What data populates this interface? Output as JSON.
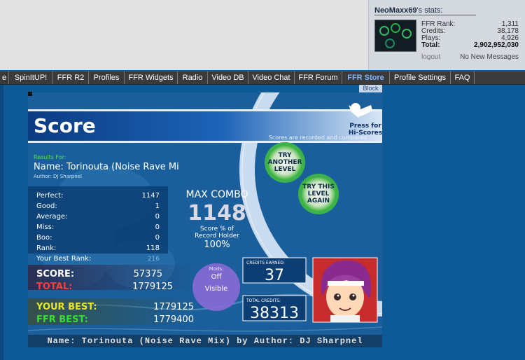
{
  "stats": {
    "username": "NeoMaxx69",
    "title_suffix": "'s stats:",
    "rows": [
      {
        "label": "FFR Rank:",
        "value": "1,311"
      },
      {
        "label": "Credits:",
        "value": "38,178"
      },
      {
        "label": "Plays:",
        "value": "4,926"
      },
      {
        "label": "Total:",
        "value": "2,902,952,030"
      }
    ],
    "logout": "logout",
    "messages": "No New Messages"
  },
  "nav": {
    "items": [
      "e",
      "SpinItUP!",
      "FFR R2",
      "Profiles",
      "FFR Widgets",
      "Radio",
      "Video DB",
      "Video Chat",
      "FFR Forum",
      "FFR Store",
      "Profile Settings",
      "FAQ"
    ],
    "block": "Block"
  },
  "game": {
    "title": "Score",
    "press_for": "Press for",
    "hi_scores": "Hi-Scores",
    "recorded": "Scores are recorded and compared",
    "results_for": "Results For:",
    "song_name": "Name: Torinouta (Noise Rave Mi",
    "author": "Author: DJ Sharpnel",
    "try_another": [
      "TRY",
      "ANOTHER",
      "LEVEL"
    ],
    "try_again": [
      "TRY THIS",
      "LEVEL",
      "AGAIN"
    ],
    "judgements": [
      {
        "label": "Perfect:",
        "value": "1147"
      },
      {
        "label": "Good:",
        "value": "1"
      },
      {
        "label": "Average:",
        "value": "0"
      },
      {
        "label": "Miss:",
        "value": "0"
      },
      {
        "label": "Boo:",
        "value": "0"
      },
      {
        "label": "Rank:",
        "value": "118"
      }
    ],
    "best_rank_label": "Your Best Rank:",
    "best_rank_value": "216",
    "max_combo_label": "MAX COMBO",
    "max_combo_value": "1148",
    "score_pct_l1": "Score % of",
    "score_pct_l2": "Record Holder",
    "score_pct_value": "100%",
    "score_label": "SCORE:",
    "score_value": "57375",
    "total_label": "TOTAL:",
    "total_value": "1779125",
    "your_best_label": "YOUR BEST:",
    "your_best_value": "1779125",
    "ffr_best_label": "FFR BEST:",
    "ffr_best_value": "1779400",
    "mods_label": "Mods:",
    "mods_value": "Off",
    "visible": "Visible",
    "credits_earned_label": "CREDITS EARNED:",
    "credits_earned_value": "37",
    "total_credits_label": "TOTAL CREDITS:",
    "total_credits_value": "38313",
    "footer": "Name: Torinouta (Noise Rave Mix) by Author: DJ Sharpnel"
  },
  "colors": {
    "score_green": "#36e02a",
    "your_best_yellow": "#e7e62a",
    "total_red": "#ff3b3b",
    "panel_blue": "#0c3e73",
    "accent_green": "#3cb24a"
  }
}
